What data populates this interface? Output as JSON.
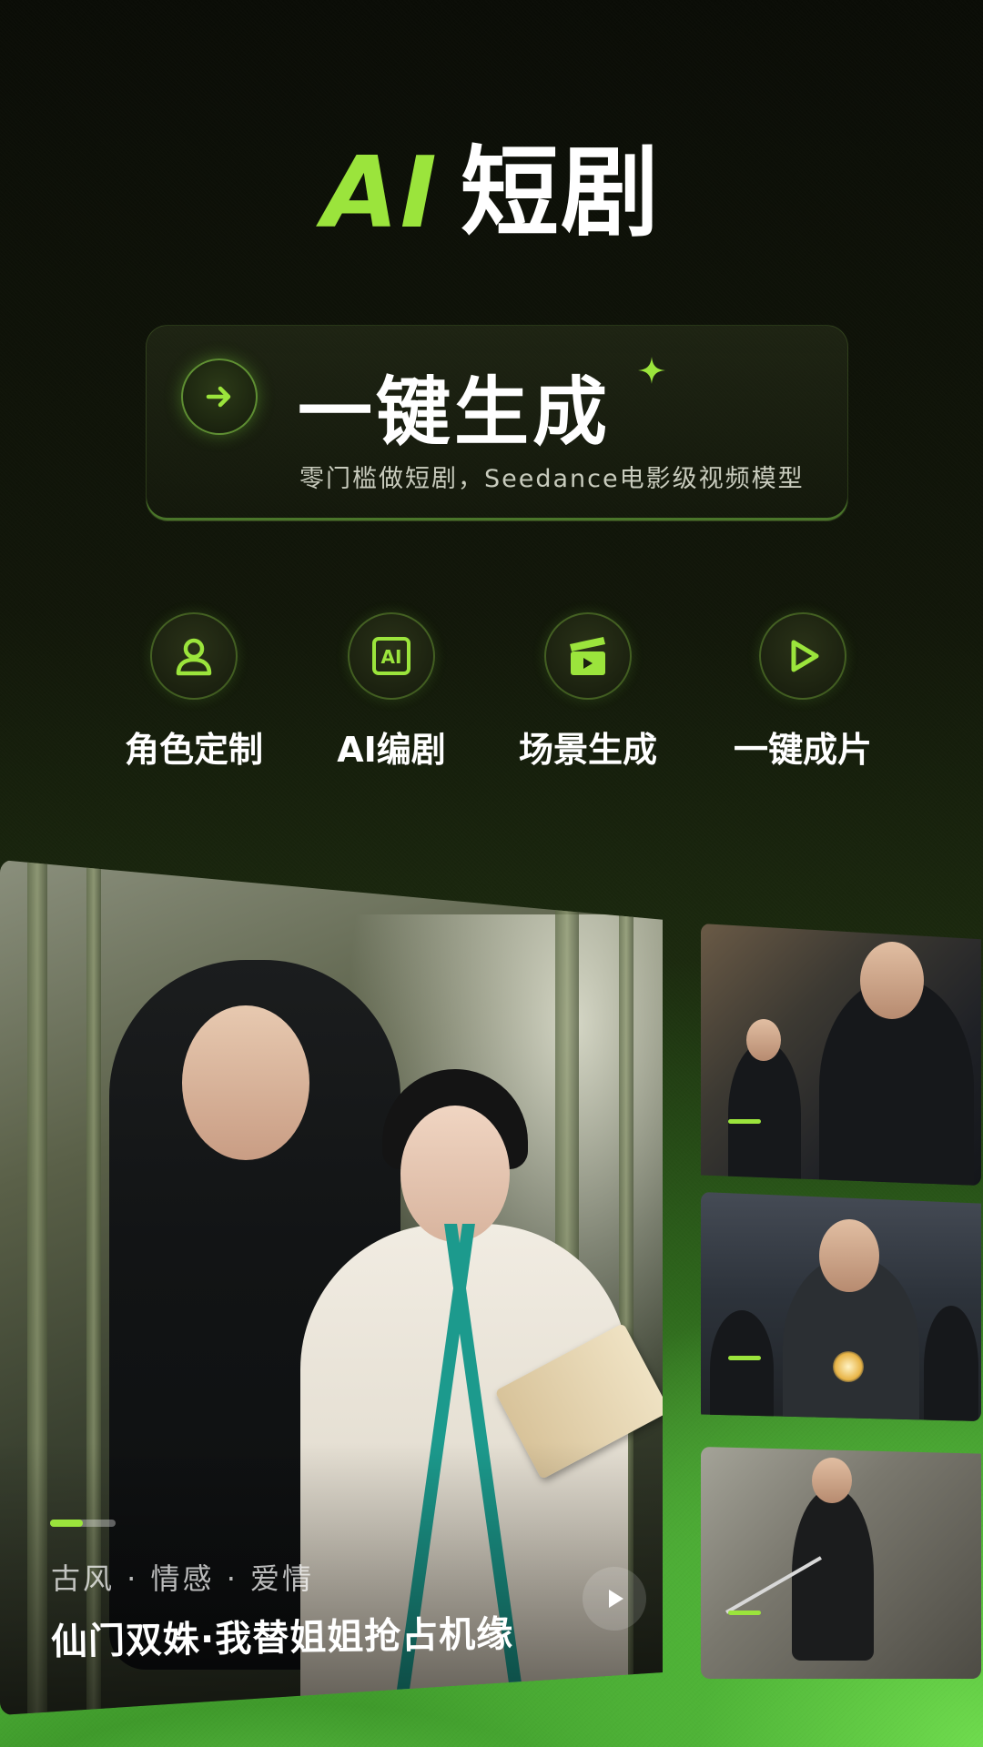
{
  "hero": {
    "title_ai": "AI",
    "title_cn": "短剧"
  },
  "panel": {
    "arrow_icon": "arrow-right-icon",
    "title": "一键生成",
    "subtitle": "零门槛做短剧，Seedance电影级视频模型"
  },
  "features": [
    {
      "icon": "user-icon",
      "label": "角色定制"
    },
    {
      "icon": "ai-script-icon",
      "label": "AI编剧"
    },
    {
      "icon": "clapperboard-icon",
      "label": "场景生成"
    },
    {
      "icon": "play-icon",
      "label": "一键成片"
    }
  ],
  "featured_card": {
    "tags": "古风 · 情感 · 爱情",
    "title": "仙门双姝·我替姐姐抢占机缘",
    "progress": 0.5
  },
  "colors": {
    "accent": "#9be43c",
    "background_dark": "#0c0f06",
    "background_green": "#6fdc4e"
  }
}
